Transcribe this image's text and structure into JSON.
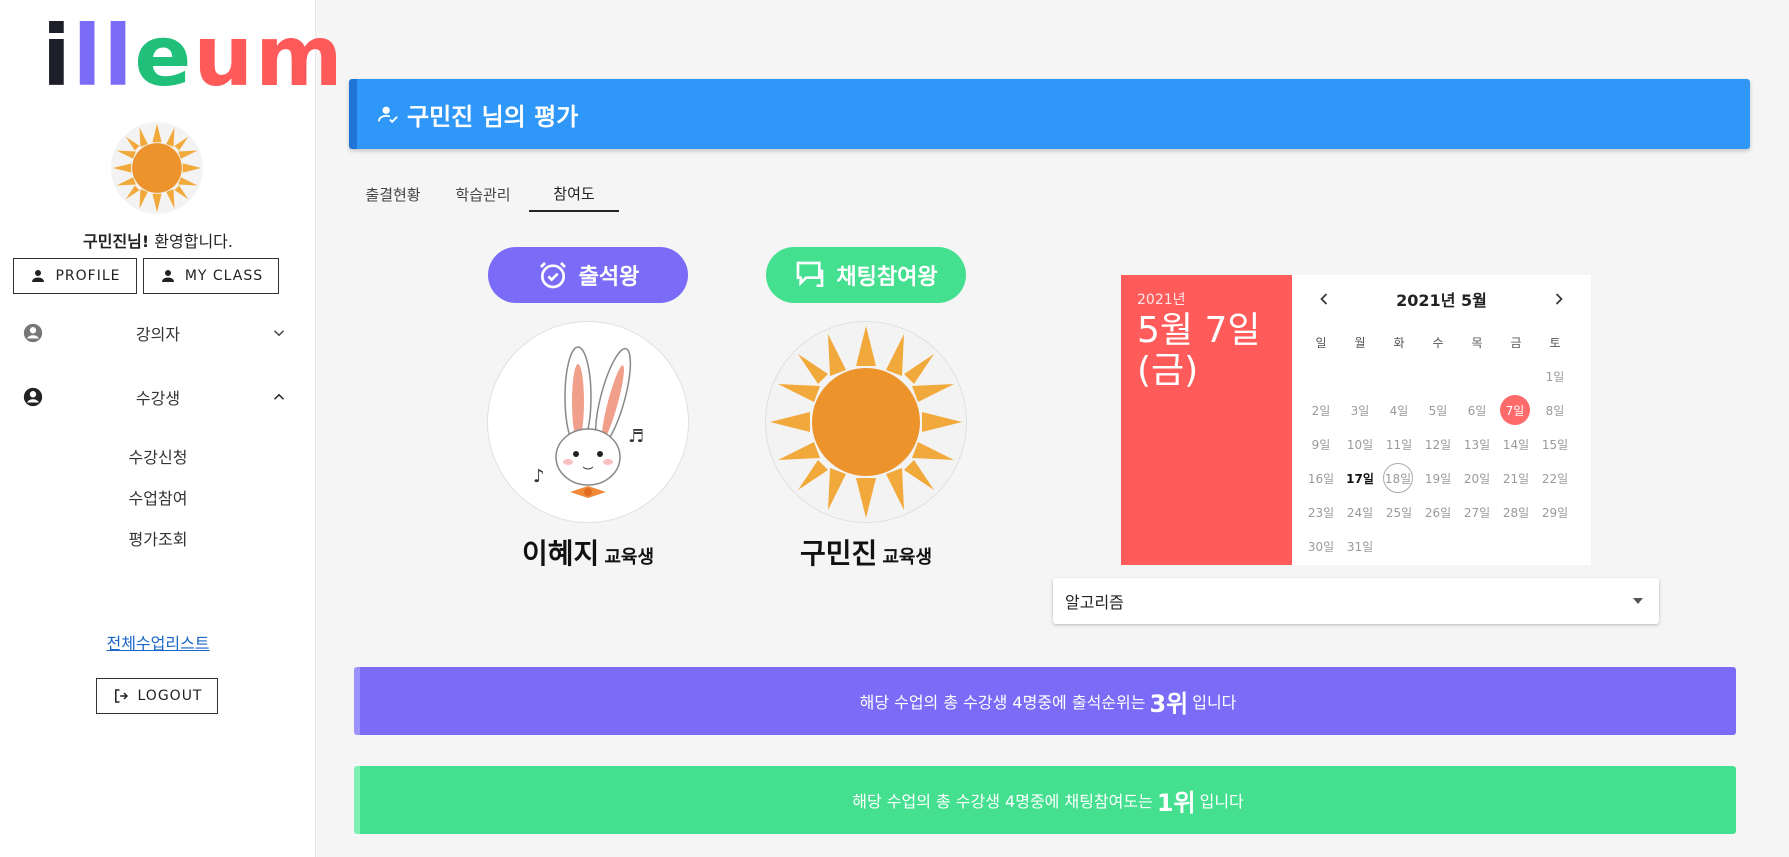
{
  "brand": {
    "logo_parts": [
      "i",
      "ll",
      "e",
      "um"
    ],
    "colors": [
      "#1e1e2a",
      "#7a6cf7",
      "#21c07a",
      "#ff5a5a"
    ]
  },
  "sidebar": {
    "welcome_name": "구민진님!",
    "welcome_text": " 환영합니다.",
    "profile_label": "PROFILE",
    "myclass_label": "MY CLASS",
    "nav": [
      {
        "label": "강의자",
        "icon": "account-circle-icon",
        "expanded": false
      },
      {
        "label": "수강생",
        "icon": "account-circle-icon",
        "expanded": true
      }
    ],
    "sub_items": [
      "수강신청",
      "수업참여",
      "평가조회"
    ],
    "all_classes_link": "전체수업리스트",
    "logout_label": "LOGOUT"
  },
  "header": {
    "title": "구민진 님의 평가",
    "icon": "person-check-icon",
    "color": "#2f97f7"
  },
  "tabs": [
    {
      "label": "출결현황",
      "active": false
    },
    {
      "label": "학습관리",
      "active": false
    },
    {
      "label": "참여도",
      "active": true
    }
  ],
  "awards": [
    {
      "title": "출석왕",
      "icon": "alarm-check-icon",
      "color": "#7a6cf7",
      "name": "이혜지",
      "role": "교육생",
      "image": "rabbit-illustration"
    },
    {
      "title": "채팅참여왕",
      "icon": "chat-icon",
      "color": "#44e08f",
      "name": "구민진",
      "role": "교육생",
      "image": "sun-illustration"
    }
  ],
  "calendar": {
    "year_label": "2021년",
    "date_label": "5월 7일",
    "weekday_label": "(금)",
    "month_title": "2021년 5월",
    "weekdays": [
      "일",
      "월",
      "화",
      "수",
      "목",
      "금",
      "토"
    ],
    "days": [
      "1일",
      "2일",
      "3일",
      "4일",
      "5일",
      "6일",
      "7일",
      "8일",
      "9일",
      "10일",
      "11일",
      "12일",
      "13일",
      "14일",
      "15일",
      "16일",
      "17일",
      "18일",
      "19일",
      "20일",
      "21일",
      "22일",
      "23일",
      "24일",
      "25일",
      "26일",
      "27일",
      "28일",
      "29일",
      "30일",
      "31일"
    ],
    "first_weekday": 6,
    "selected_day": 7,
    "bold_day": 17,
    "ring_day": 18
  },
  "subject_select": {
    "value": "알고리즘"
  },
  "rank_messages": [
    {
      "prefix": "해당 수업의 총 수강생 4명중에 출석순위는",
      "rank": "3위",
      "suffix": "입니다",
      "color": "#7a6cf7",
      "border": "#9c92fb"
    },
    {
      "prefix": "해당 수업의 총 수강생 4명중에 채팅참여도는",
      "rank": "1위",
      "suffix": "입니다",
      "color": "#44e08f",
      "border": "#7ef0b4"
    }
  ]
}
